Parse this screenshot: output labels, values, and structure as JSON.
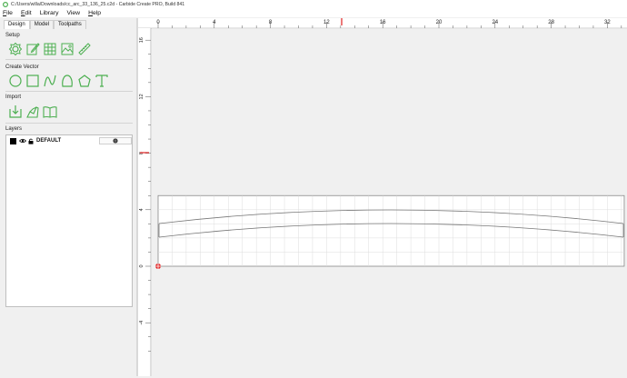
{
  "window": {
    "title": "C:/Users/willa/Downloads/cc_arc_33_136_25.c2d - Carbide Create PRO, Build 841"
  },
  "menu": [
    {
      "label": "File",
      "mn": "F",
      "rest": "ile"
    },
    {
      "label": "Edit",
      "mn": "E",
      "rest": "dit"
    },
    {
      "label": "Library",
      "mn": "",
      "rest": "Library"
    },
    {
      "label": "View",
      "mn": "",
      "rest": "View"
    },
    {
      "label": "Help",
      "mn": "H",
      "rest": "elp"
    }
  ],
  "tabs": [
    {
      "label": "Design",
      "active": true
    },
    {
      "label": "Model",
      "active": false
    },
    {
      "label": "Toolpaths",
      "active": false
    }
  ],
  "sections": {
    "setup": "Setup",
    "create_vector": "Create Vector",
    "import": "Import",
    "layers": "Layers"
  },
  "icons": {
    "setup": [
      "gear-icon",
      "edit-pencil-icon",
      "grid-icon",
      "image-icon",
      "ruler-icon"
    ],
    "create_vector": [
      "circle-icon",
      "rectangle-icon",
      "curve-icon",
      "polygon-shape-icon",
      "pentagon-icon",
      "text-icon"
    ],
    "import": [
      "import-file-icon",
      "import-3d-icon",
      "library-book-icon"
    ]
  },
  "layers": [
    {
      "name": "DEFAULT",
      "color": "#000000"
    }
  ],
  "colors": {
    "accent": "#4caf50",
    "cursor_marker": "#e02020"
  },
  "rulers": {
    "x_ticks": [
      "0",
      "4",
      "8",
      "12",
      "16",
      "20",
      "24",
      "28",
      "32"
    ],
    "y_ticks": [
      "16",
      "12",
      "8",
      "4",
      "0",
      "-4"
    ]
  }
}
